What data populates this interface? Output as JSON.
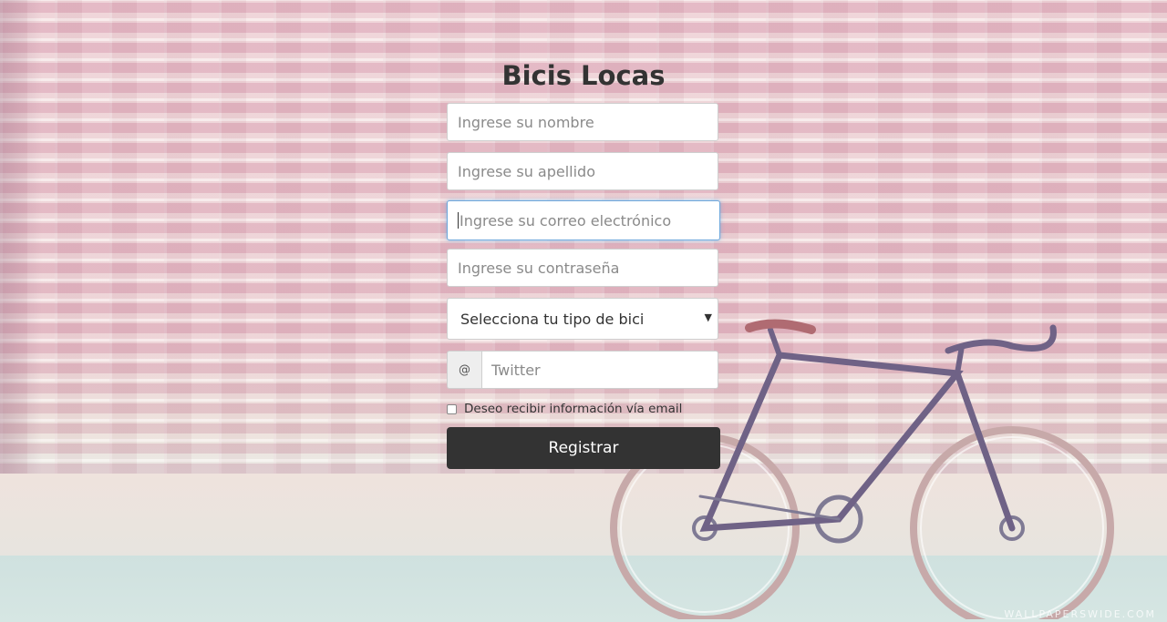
{
  "form": {
    "title": "Bicis Locas",
    "name_placeholder": "Ingrese su nombre",
    "lastname_placeholder": "Ingrese su apellido",
    "email_placeholder": "Ingrese su correo electrónico",
    "password_placeholder": "Ingrese su contraseña",
    "bike_type_selected": "Selecciona tu tipo de bici",
    "twitter_addon": "@",
    "twitter_placeholder": "Twitter",
    "newsletter_label": "Deseo recibir información vía email",
    "submit_label": "Registrar"
  },
  "background": {
    "watermark": "WALLPAPERSWIDE.COM"
  },
  "colors": {
    "button_bg": "#333333",
    "focus_border": "#6fa8dc",
    "title": "#333333"
  }
}
